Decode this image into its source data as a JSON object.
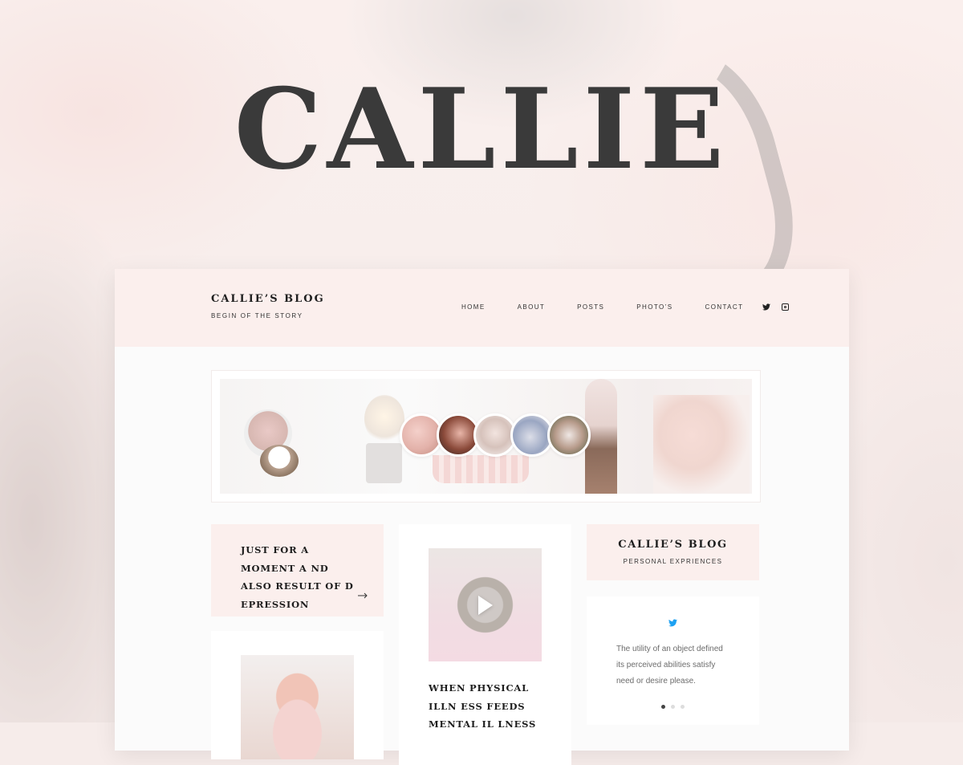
{
  "hero": {
    "title": "CALLIE"
  },
  "header": {
    "brand_title": "CALLIE’S BLOG",
    "brand_subtitle": "BEGIN OF THE STORY",
    "nav": [
      "HOME",
      "ABOUT",
      "POSTS",
      "PHOTO’S",
      "CONTACT"
    ],
    "social_icons": [
      "twitter-icon",
      "instagram-icon"
    ]
  },
  "posts": {
    "left_card_title": "JUST FOR A MOMENT A ND ALSO RESULT OF D EPRESSION",
    "middle_card_title": "WHEN PHYSICAL ILLN ESS FEEDS MENTAL IL LNESS"
  },
  "sidebar": {
    "widget_title": "CALLIE’S BLOG",
    "widget_subtitle": "PERSONAL EXPRIENCES",
    "tweet_text": "The utility of an object defined its perceived abilities satisfy need or desire please.",
    "carousel_dots": 3,
    "carousel_active": 1
  },
  "colors": {
    "header_bg": "#fbefed",
    "accent_twitter": "#1da1f2",
    "text_dark": "#1e1e1e"
  }
}
